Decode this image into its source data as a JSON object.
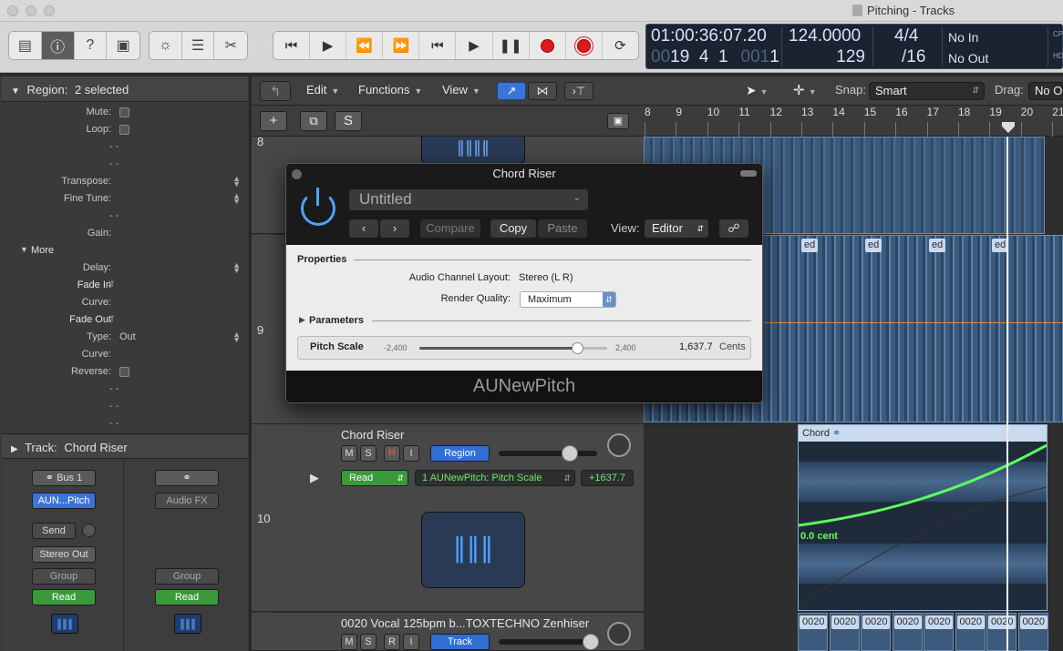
{
  "window": {
    "title": "Pitching - Tracks"
  },
  "lcd": {
    "position_time": "01:00:36:07.20",
    "position_bars_bright": "19  4  1",
    "position_bars_dim_a": "00",
    "position_bars_dim_b": "001",
    "position_bars_last": "1",
    "tempo_top": "124.0000",
    "tempo_bottom": "129",
    "sig_top": "4/4",
    "sig_bottom": "/16",
    "in_label": "No In",
    "out_label": "No Out",
    "edge_top": "CPU",
    "edge_bottom": "HD"
  },
  "toolbar": {
    "left_icons": [
      "library-icon",
      "info-icon",
      "help-icon",
      "editors-icon"
    ],
    "mid_icons": [
      "tuner-icon",
      "mixer-icon",
      "scissors-icon"
    ],
    "transport": [
      "go-to-start-icon",
      "play-from-selection-icon",
      "rewind-icon",
      "fast-forward-icon",
      "go-to-beginning-icon",
      "play-icon",
      "pause-icon",
      "record-icon",
      "capture-record-icon",
      "cycle-icon"
    ]
  },
  "inspector": {
    "region_label": "Region:",
    "region_value": "2 selected",
    "rows": [
      {
        "label": "Mute:",
        "type": "check"
      },
      {
        "label": "Loop:",
        "type": "check"
      },
      {
        "label": "",
        "value": "- -"
      },
      {
        "label": "",
        "value": "- -"
      },
      {
        "label": "Transpose:",
        "type": "stepper"
      },
      {
        "label": "Fine Tune:",
        "type": "stepper"
      },
      {
        "label": "",
        "value": "- -"
      },
      {
        "label": "Gain:"
      },
      {
        "label": "More",
        "type": "group"
      },
      {
        "label": "Delay:",
        "type": "stepper"
      },
      {
        "label": "Fade In",
        "type": "bold"
      },
      {
        "label": "Curve:"
      },
      {
        "label": "Fade Out",
        "type": "bold"
      },
      {
        "label": "Type:",
        "value": "Out",
        "type": "stepper"
      },
      {
        "label": "Curve:"
      },
      {
        "label": "Reverse:",
        "type": "check"
      },
      {
        "label": "",
        "value": "- -"
      },
      {
        "label": "",
        "value": "- -"
      },
      {
        "label": "",
        "value": "- -"
      }
    ],
    "track_label": "Track:",
    "track_value": "Chord Riser",
    "strip1": {
      "link": "Bus 1",
      "plugin": "AUN...Pitch",
      "send": "Send",
      "output": "Stereo Out",
      "group": "Group",
      "automation": "Read"
    },
    "strip2": {
      "plugin": "Audio FX",
      "group": "Group",
      "automation": "Read"
    }
  },
  "tracks_toolbar": {
    "edit": "Edit",
    "functions": "Functions",
    "view": "View",
    "snap_label": "Snap:",
    "snap_value": "Smart",
    "drag_label": "Drag:",
    "drag_value": "No O"
  },
  "header_row": {
    "add": "+",
    "solo": "S"
  },
  "ruler": {
    "bars": [
      "8",
      "9",
      "10",
      "11",
      "12",
      "13",
      "14",
      "15",
      "16",
      "17",
      "18",
      "19",
      "20",
      "21"
    ]
  },
  "tracks": [
    {
      "number": "8"
    },
    {
      "number": "9"
    },
    {
      "number": "10",
      "name": "Chord Riser",
      "m": "M",
      "s": "S",
      "r": "R",
      "i": "I",
      "region_btn": "Region",
      "automation_mode": "Read",
      "automation_param": "1 AUNewPitch: Pitch Scale",
      "automation_value": "+1637.7"
    },
    {
      "name": "0020 Vocal 125bpm b...TOXTECHNO Zenhiser",
      "m": "M",
      "s": "S",
      "r": "R",
      "i": "I",
      "track_btn": "Track"
    }
  ],
  "regions": {
    "ed_labels": [
      "ed",
      "ed",
      "ed",
      "ed"
    ],
    "chord_label": "Chord",
    "automation_label": "0.0 cent",
    "bottom_labels": [
      "0020",
      "0020",
      "0020",
      "0020",
      "0020",
      "0020",
      "0020",
      "0020"
    ]
  },
  "plugin": {
    "title": "Chord Riser",
    "preset": "Untitled",
    "compare": "Compare",
    "copy": "Copy",
    "paste": "Paste",
    "view_label": "View:",
    "view_value": "Editor",
    "properties_label": "Properties",
    "channel_layout_label": "Audio Channel Layout:",
    "channel_layout_value": "Stereo (L R)",
    "render_quality_label": "Render Quality:",
    "render_quality_value": "Maximum",
    "parameters_label": "Parameters",
    "pitch_scale_label": "Pitch Scale",
    "pitch_min": "-2,400",
    "pitch_max": "2,400",
    "pitch_value": "1,637.7",
    "pitch_units": "Cents",
    "pitch_fraction": 0.841,
    "footer": "AUNewPitch"
  },
  "colors": {
    "accent_blue": "#3d8bff",
    "automation_green": "#5cff5c",
    "record_red": "#e0191e"
  }
}
